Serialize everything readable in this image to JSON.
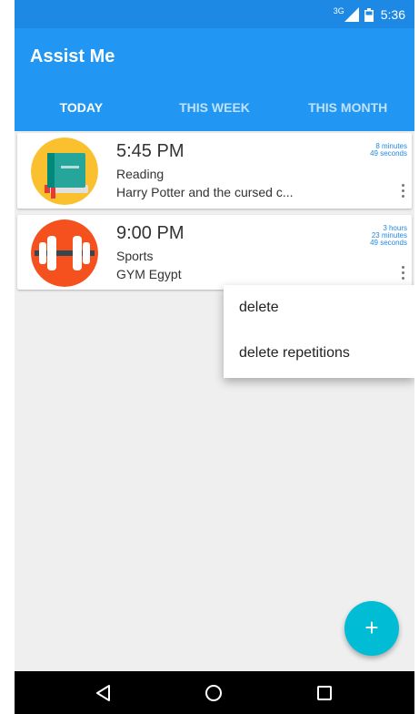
{
  "status_bar": {
    "network": "3G",
    "time": "5:36",
    "icons": [
      "signal-icon",
      "battery-icon"
    ]
  },
  "app_bar": {
    "title": "Assist Me",
    "color": "#2196f3",
    "tabs": [
      {
        "label": "TODAY",
        "active": true
      },
      {
        "label": "THIS WEEK",
        "active": false
      },
      {
        "label": "THIS MONTH",
        "active": false
      }
    ]
  },
  "reminders": [
    {
      "icon": "book-icon",
      "time": "5:45 PM",
      "category": "Reading",
      "detail": "Harry Potter and the cursed c...",
      "countdown": [
        "8 minutes",
        "49 seconds"
      ]
    },
    {
      "icon": "dumbbell-icon",
      "time": "9:00 PM",
      "category": "Sports",
      "detail": "GYM Egypt",
      "countdown": [
        "3 hours",
        "23 minutes",
        "49 seconds"
      ]
    }
  ],
  "popup_menu": {
    "items": [
      "delete",
      "delete repetitions"
    ]
  },
  "fab": {
    "label": "+",
    "color": "#00bcd4"
  },
  "nav_bar": {
    "icons": [
      "back-icon",
      "home-icon",
      "recents-icon"
    ]
  }
}
